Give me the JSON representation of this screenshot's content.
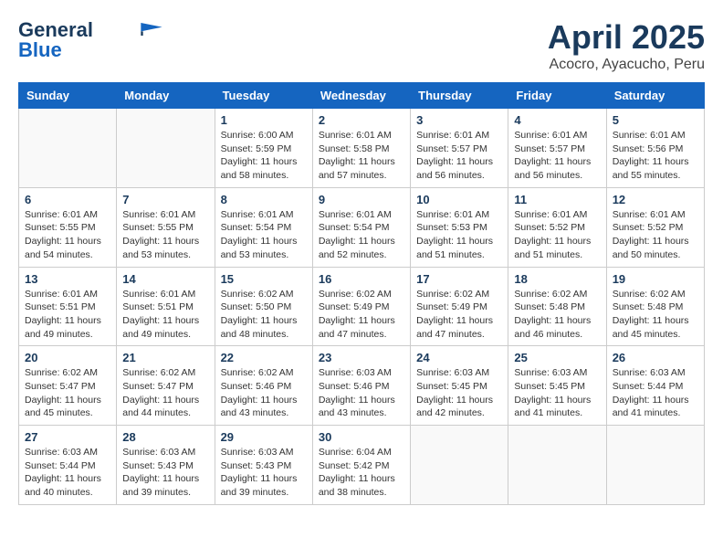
{
  "header": {
    "logo_line1": "General",
    "logo_line2": "Blue",
    "month": "April 2025",
    "location": "Acocro, Ayacucho, Peru"
  },
  "weekdays": [
    "Sunday",
    "Monday",
    "Tuesday",
    "Wednesday",
    "Thursday",
    "Friday",
    "Saturday"
  ],
  "weeks": [
    [
      {
        "day": "",
        "info": ""
      },
      {
        "day": "",
        "info": ""
      },
      {
        "day": "1",
        "info": "Sunrise: 6:00 AM\nSunset: 5:59 PM\nDaylight: 11 hours and 58 minutes."
      },
      {
        "day": "2",
        "info": "Sunrise: 6:01 AM\nSunset: 5:58 PM\nDaylight: 11 hours and 57 minutes."
      },
      {
        "day": "3",
        "info": "Sunrise: 6:01 AM\nSunset: 5:57 PM\nDaylight: 11 hours and 56 minutes."
      },
      {
        "day": "4",
        "info": "Sunrise: 6:01 AM\nSunset: 5:57 PM\nDaylight: 11 hours and 56 minutes."
      },
      {
        "day": "5",
        "info": "Sunrise: 6:01 AM\nSunset: 5:56 PM\nDaylight: 11 hours and 55 minutes."
      }
    ],
    [
      {
        "day": "6",
        "info": "Sunrise: 6:01 AM\nSunset: 5:55 PM\nDaylight: 11 hours and 54 minutes."
      },
      {
        "day": "7",
        "info": "Sunrise: 6:01 AM\nSunset: 5:55 PM\nDaylight: 11 hours and 53 minutes."
      },
      {
        "day": "8",
        "info": "Sunrise: 6:01 AM\nSunset: 5:54 PM\nDaylight: 11 hours and 53 minutes."
      },
      {
        "day": "9",
        "info": "Sunrise: 6:01 AM\nSunset: 5:54 PM\nDaylight: 11 hours and 52 minutes."
      },
      {
        "day": "10",
        "info": "Sunrise: 6:01 AM\nSunset: 5:53 PM\nDaylight: 11 hours and 51 minutes."
      },
      {
        "day": "11",
        "info": "Sunrise: 6:01 AM\nSunset: 5:52 PM\nDaylight: 11 hours and 51 minutes."
      },
      {
        "day": "12",
        "info": "Sunrise: 6:01 AM\nSunset: 5:52 PM\nDaylight: 11 hours and 50 minutes."
      }
    ],
    [
      {
        "day": "13",
        "info": "Sunrise: 6:01 AM\nSunset: 5:51 PM\nDaylight: 11 hours and 49 minutes."
      },
      {
        "day": "14",
        "info": "Sunrise: 6:01 AM\nSunset: 5:51 PM\nDaylight: 11 hours and 49 minutes."
      },
      {
        "day": "15",
        "info": "Sunrise: 6:02 AM\nSunset: 5:50 PM\nDaylight: 11 hours and 48 minutes."
      },
      {
        "day": "16",
        "info": "Sunrise: 6:02 AM\nSunset: 5:49 PM\nDaylight: 11 hours and 47 minutes."
      },
      {
        "day": "17",
        "info": "Sunrise: 6:02 AM\nSunset: 5:49 PM\nDaylight: 11 hours and 47 minutes."
      },
      {
        "day": "18",
        "info": "Sunrise: 6:02 AM\nSunset: 5:48 PM\nDaylight: 11 hours and 46 minutes."
      },
      {
        "day": "19",
        "info": "Sunrise: 6:02 AM\nSunset: 5:48 PM\nDaylight: 11 hours and 45 minutes."
      }
    ],
    [
      {
        "day": "20",
        "info": "Sunrise: 6:02 AM\nSunset: 5:47 PM\nDaylight: 11 hours and 45 minutes."
      },
      {
        "day": "21",
        "info": "Sunrise: 6:02 AM\nSunset: 5:47 PM\nDaylight: 11 hours and 44 minutes."
      },
      {
        "day": "22",
        "info": "Sunrise: 6:02 AM\nSunset: 5:46 PM\nDaylight: 11 hours and 43 minutes."
      },
      {
        "day": "23",
        "info": "Sunrise: 6:03 AM\nSunset: 5:46 PM\nDaylight: 11 hours and 43 minutes."
      },
      {
        "day": "24",
        "info": "Sunrise: 6:03 AM\nSunset: 5:45 PM\nDaylight: 11 hours and 42 minutes."
      },
      {
        "day": "25",
        "info": "Sunrise: 6:03 AM\nSunset: 5:45 PM\nDaylight: 11 hours and 41 minutes."
      },
      {
        "day": "26",
        "info": "Sunrise: 6:03 AM\nSunset: 5:44 PM\nDaylight: 11 hours and 41 minutes."
      }
    ],
    [
      {
        "day": "27",
        "info": "Sunrise: 6:03 AM\nSunset: 5:44 PM\nDaylight: 11 hours and 40 minutes."
      },
      {
        "day": "28",
        "info": "Sunrise: 6:03 AM\nSunset: 5:43 PM\nDaylight: 11 hours and 39 minutes."
      },
      {
        "day": "29",
        "info": "Sunrise: 6:03 AM\nSunset: 5:43 PM\nDaylight: 11 hours and 39 minutes."
      },
      {
        "day": "30",
        "info": "Sunrise: 6:04 AM\nSunset: 5:42 PM\nDaylight: 11 hours and 38 minutes."
      },
      {
        "day": "",
        "info": ""
      },
      {
        "day": "",
        "info": ""
      },
      {
        "day": "",
        "info": ""
      }
    ]
  ]
}
